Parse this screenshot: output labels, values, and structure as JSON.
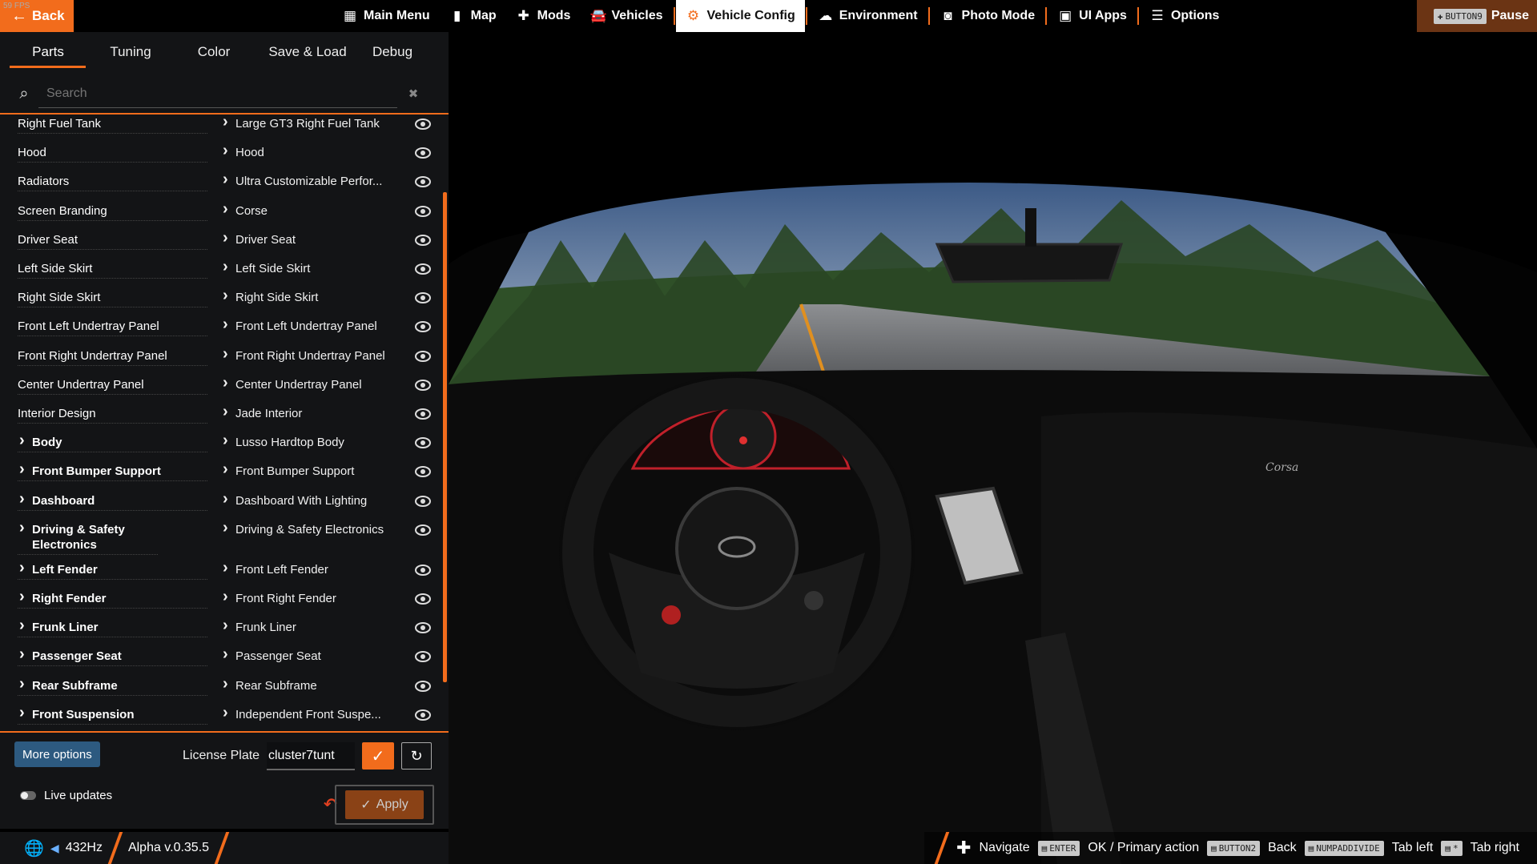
{
  "fps": "59 FPS",
  "back_label": "Back",
  "nav": [
    {
      "id": "main-menu",
      "icon": "grid-icon",
      "glyph": "▦",
      "label": "Main Menu"
    },
    {
      "id": "map",
      "icon": "map-icon",
      "glyph": "▮",
      "label": "Map"
    },
    {
      "id": "mods",
      "icon": "puzzle-icon",
      "glyph": "✚",
      "label": "Mods"
    },
    {
      "id": "vehicles",
      "icon": "car-icon",
      "glyph": "🚘",
      "label": "Vehicles"
    },
    {
      "id": "vehicle-config",
      "icon": "engine-icon",
      "glyph": "⚙",
      "label": "Vehicle Config",
      "active": true
    },
    {
      "id": "environment",
      "icon": "weather-icon",
      "glyph": "☁",
      "label": "Environment"
    },
    {
      "id": "photo-mode",
      "icon": "camera-icon",
      "glyph": "◙",
      "label": "Photo Mode"
    },
    {
      "id": "ui-apps",
      "icon": "apps-icon",
      "glyph": "▣",
      "label": "UI Apps"
    },
    {
      "id": "options",
      "icon": "sliders-icon",
      "glyph": "☰",
      "label": "Options"
    }
  ],
  "pause": {
    "key": "BUTTON9",
    "label": "Pause"
  },
  "tabs": [
    "Parts",
    "Tuning",
    "Color",
    "Save & Load",
    "Debug"
  ],
  "search": {
    "placeholder": "Search",
    "value": "Search"
  },
  "parts": [
    {
      "slot": "Right Fuel Tank",
      "choice": "Large GT3 Right Fuel Tank",
      "group": false
    },
    {
      "slot": "Hood",
      "choice": "Hood",
      "group": false
    },
    {
      "slot": "Radiators",
      "choice": "Ultra Customizable Perfor...",
      "group": false
    },
    {
      "slot": "Screen Branding",
      "choice": "Corse",
      "group": false
    },
    {
      "slot": "Driver Seat",
      "choice": "Driver Seat",
      "group": false
    },
    {
      "slot": "Left Side Skirt",
      "choice": "Left Side Skirt",
      "group": false
    },
    {
      "slot": "Right Side Skirt",
      "choice": "Right Side Skirt",
      "group": false
    },
    {
      "slot": "Front Left Undertray Panel",
      "choice": "Front Left Undertray Panel",
      "group": false
    },
    {
      "slot": "Front Right Undertray Panel",
      "choice": "Front Right Undertray Panel",
      "group": false
    },
    {
      "slot": "Center Undertray Panel",
      "choice": "Center Undertray Panel",
      "group": false
    },
    {
      "slot": "Interior Design",
      "choice": "Jade Interior",
      "group": false
    },
    {
      "slot": "Body",
      "choice": "Lusso Hardtop Body",
      "group": true
    },
    {
      "slot": "Front Bumper Support",
      "choice": "Front Bumper Support",
      "group": true
    },
    {
      "slot": "Dashboard",
      "choice": "Dashboard With Lighting",
      "group": true
    },
    {
      "slot": "Driving & Safety Electronics",
      "choice": "Driving & Safety Electronics",
      "group": true
    },
    {
      "slot": "Left Fender",
      "choice": "Front Left Fender",
      "group": true
    },
    {
      "slot": "Right Fender",
      "choice": "Front Right Fender",
      "group": true
    },
    {
      "slot": "Frunk Liner",
      "choice": "Frunk Liner",
      "group": true
    },
    {
      "slot": "Passenger Seat",
      "choice": "Passenger Seat",
      "group": true
    },
    {
      "slot": "Rear Subframe",
      "choice": "Rear Subframe",
      "group": true
    },
    {
      "slot": "Front Suspension",
      "choice": "Independent Front Suspe...",
      "group": true
    }
  ],
  "controls": {
    "more_options": "More options",
    "license_label": "License Plate",
    "license_value": "cluster7tunt",
    "live_updates": "Live updates",
    "apply": "Apply"
  },
  "status": {
    "rate": "432Hz",
    "version": "Alpha v.0.35.5"
  },
  "hints": [
    {
      "key": "",
      "label": "Navigate"
    },
    {
      "key": "ENTER",
      "label": "OK / Primary action"
    },
    {
      "key": "BUTTON2",
      "label": "Back"
    },
    {
      "key": "NUMPADDIVIDE",
      "label": "Tab left"
    },
    {
      "key": "*",
      "label": "Tab right"
    }
  ],
  "colors": {
    "accent": "#f26c1c",
    "panel": "#141518",
    "more_btn": "#2d5a80"
  }
}
